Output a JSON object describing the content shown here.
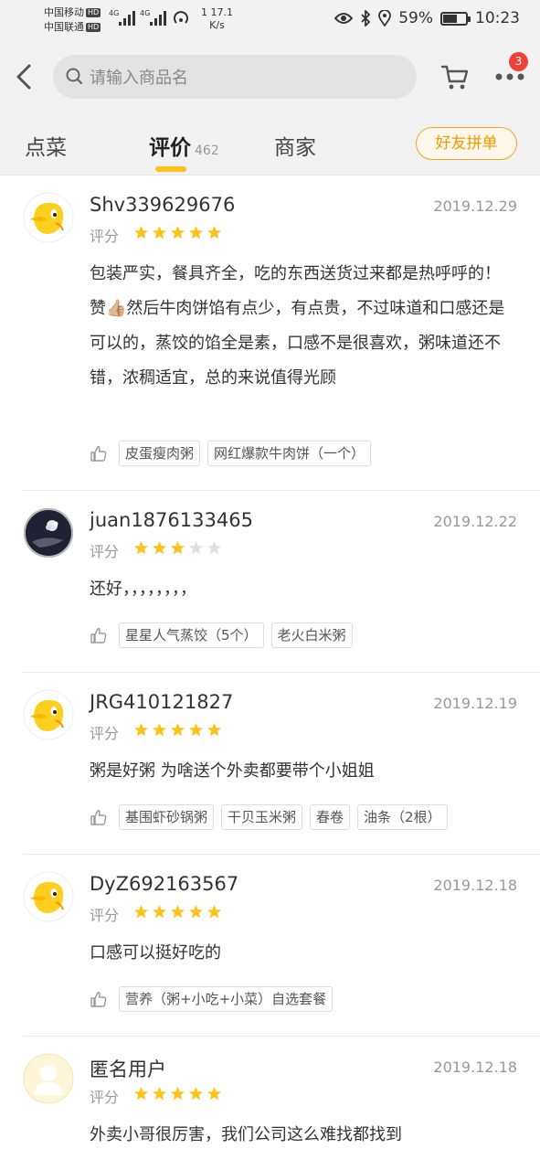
{
  "status_bar": {
    "carrier1": "中国移动",
    "carrier2": "中国联通",
    "hd": "HD",
    "net1": "4G",
    "net2": "4G",
    "speed_value": "17.1",
    "speed_unit": "K/s",
    "speed_prefix": "1",
    "battery": "59%",
    "time": "10:23"
  },
  "header": {
    "search_placeholder": "请输入商品名",
    "more_badge": "3"
  },
  "tabs": {
    "order": "点菜",
    "reviews": "评价",
    "reviews_count": "462",
    "merchant": "商家",
    "group_button": "好友拼单"
  },
  "colors": {
    "accent": "#ffc21a",
    "badge": "#ef4136",
    "star_on": "#ffc21a",
    "star_off": "#e0e0e0"
  },
  "reviews": [
    {
      "user": "Shv339629676",
      "date": "2019.12.29",
      "score_label": "评分",
      "rating": 5,
      "content": "包装严实，餐具齐全，吃的东西送货过来都是热呼呼的！赞👍🏼然后牛肉饼馅有点少，有点贵，不过味道和口感还是可以的，蒸饺的馅全是素，口感不是很喜欢，粥味道还不错，浓稠适宜，总的来说值得光顾",
      "tags": [
        "皮蛋瘦肉粥",
        "网红爆款牛肉饼（一个）"
      ],
      "avatar": "duck"
    },
    {
      "user": "juan1876133465",
      "date": "2019.12.22",
      "score_label": "评分",
      "rating": 3,
      "content": "还好，，，，，，，，",
      "tags": [
        "星星人气蒸饺（5个）",
        "老火白米粥"
      ],
      "avatar": "photo"
    },
    {
      "user": "JRG410121827",
      "date": "2019.12.19",
      "score_label": "评分",
      "rating": 5,
      "content": "粥是好粥 为啥送个外卖都要带个小姐姐",
      "tags": [
        "基围虾砂锅粥",
        "干贝玉米粥",
        "春卷",
        "油条（2根）"
      ],
      "avatar": "duck"
    },
    {
      "user": "DyZ692163567",
      "date": "2019.12.18",
      "score_label": "评分",
      "rating": 5,
      "content": "口感可以挺好吃的",
      "tags": [
        "营养（粥+小吃+小菜）自选套餐"
      ],
      "avatar": "duck"
    },
    {
      "user": "匿名用户",
      "date": "2019.12.18",
      "score_label": "评分",
      "rating": 5,
      "content": "外卖小哥很厉害，我们公司这么难找都找到",
      "tags": [],
      "avatar": "anon"
    }
  ]
}
